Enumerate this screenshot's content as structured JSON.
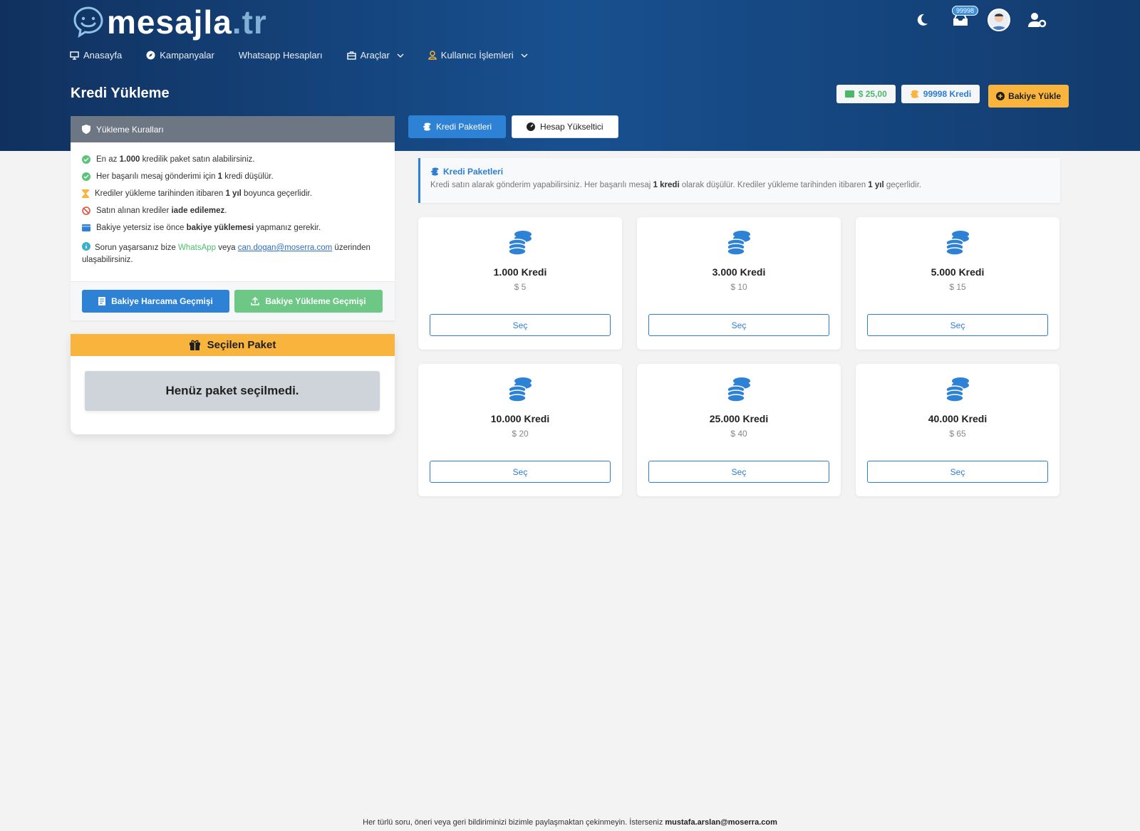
{
  "brand": {
    "name": "mesajla",
    "tld": ".tr"
  },
  "topbar": {
    "notification_count": "99998"
  },
  "nav": [
    {
      "label": "Anasayfa"
    },
    {
      "label": "Kampanyalar"
    },
    {
      "label": "Whatsapp Hesapları"
    },
    {
      "label": "Araçlar"
    },
    {
      "label": "Kullanıcı İşlemleri"
    }
  ],
  "page": {
    "title": "Kredi Yükleme"
  },
  "header_actions": {
    "balance": "$ 25,00",
    "credits": "99998 Kredi",
    "load_button": "Bakiye Yükle"
  },
  "rules_card": {
    "title": "Yükleme Kuralları",
    "rules": [
      {
        "pre": "En az ",
        "bold": "1.000",
        "post": " kredilik paket satın alabilirsiniz."
      },
      {
        "pre": "Her başarılı mesaj gönderimi için ",
        "bold": "1",
        "post": " kredi düşülür."
      },
      {
        "pre": "Krediler yükleme tarihinden itibaren ",
        "bold": "1 yıl",
        "post": " boyunca geçerlidir."
      },
      {
        "pre": "Satın alınan krediler ",
        "bold": "iade edilemez",
        "post": "."
      },
      {
        "pre": "Bakiye yetersiz ise önce ",
        "bold": "bakiye yüklemesi",
        "post": " yapmanız gerekir."
      }
    ],
    "contact": {
      "pre": "Sorun yaşarsanız bize ",
      "whatsapp": "WhatsApp",
      "mid": " veya ",
      "email": "can.dogan@moserra.com",
      "post": " üzerinden ulaşabilirsiniz."
    },
    "spend_history_button": "Bakiye Harcama Geçmişi",
    "load_history_button": "Bakiye Yükleme Geçmişi"
  },
  "selected_package": {
    "title": "Seçilen Paket",
    "empty_text": "Henüz paket seçilmedi."
  },
  "tabs": [
    {
      "label": "Kredi Paketleri",
      "active": true
    },
    {
      "label": "Hesap Yükseltici",
      "active": false
    }
  ],
  "info": {
    "title": "Kredi Paketleri",
    "text_pre": "Kredi satın alarak gönderim yapabilirsiniz. Her başarılı mesaj ",
    "text_bold1": "1 kredi",
    "text_mid": " olarak düşülür. Krediler yükleme tarihinden itibaren ",
    "text_bold2": "1 yıl",
    "text_post": " geçerlidir."
  },
  "packages": [
    {
      "name": "1.000 Kredi",
      "price": "$ 5",
      "button": "Seç"
    },
    {
      "name": "3.000 Kredi",
      "price": "$ 10",
      "button": "Seç"
    },
    {
      "name": "5.000 Kredi",
      "price": "$ 15",
      "button": "Seç"
    },
    {
      "name": "10.000 Kredi",
      "price": "$ 20",
      "button": "Seç"
    },
    {
      "name": "25.000 Kredi",
      "price": "$ 40",
      "button": "Seç"
    },
    {
      "name": "40.000 Kredi",
      "price": "$ 65",
      "button": "Seç"
    }
  ],
  "footer": {
    "text": "Her türlü soru, öneri veya geri bildiriminizi bizimle paylaşmaktan çekinmeyin. İsterseniz ",
    "email": "mustafa.arslan@moserra.com"
  },
  "colors": {
    "primary": "#2d82d6",
    "warning": "#f8b43c",
    "success": "#6dc886",
    "header": "#16457d"
  }
}
